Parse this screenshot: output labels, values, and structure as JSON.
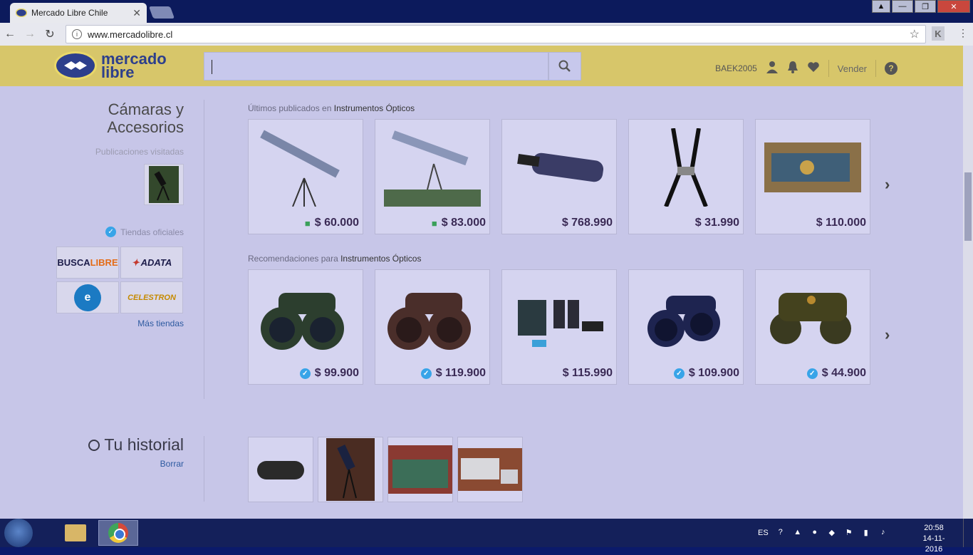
{
  "browser": {
    "tab_title": "Mercado Libre Chile",
    "tab_close": "✕",
    "url": "www.mercadolibre.cl",
    "nav": {
      "back": "←",
      "forward": "→",
      "reload": "↻"
    },
    "window_controls": {
      "user": "▲",
      "minimize": "—",
      "maximize": "❐",
      "close": "✕"
    },
    "extension_label": "K",
    "menu": "⋮"
  },
  "header": {
    "logo_line1": "mercado",
    "logo_line2": "libre",
    "search_placeholder": "",
    "username": "BAEK2005",
    "sell_label": "Vender",
    "help_label": "?"
  },
  "sidebar": {
    "category_line1": "Cámaras y",
    "category_line2": "Accesorios",
    "visited_label": "Publicaciones visitadas",
    "official_label": "Tiendas oficiales",
    "stores": [
      {
        "name_a": "BUSCA",
        "name_b": "LIBRE"
      },
      {
        "name": "ADATA"
      },
      {
        "name": "e-store"
      },
      {
        "name": "CELESTRON"
      }
    ],
    "more_stores": "Más tiendas"
  },
  "latest": {
    "title_prefix": "Últimos publicados en",
    "title_category": "Instrumentos Ópticos",
    "items": [
      {
        "price": "$ 60.000",
        "free_shipping": true
      },
      {
        "price": "$ 83.000",
        "free_shipping": true
      },
      {
        "price": "$ 768.990",
        "free_shipping": false
      },
      {
        "price": "$ 31.990",
        "free_shipping": false
      },
      {
        "price": "$ 110.000",
        "free_shipping": false
      }
    ]
  },
  "recommendations": {
    "title_prefix": "Recomendaciones para",
    "title_category": "Instrumentos Ópticos",
    "items": [
      {
        "price": "$ 99.900",
        "official": true
      },
      {
        "price": "$ 119.900",
        "official": true
      },
      {
        "price": "$ 115.990",
        "official": false
      },
      {
        "price": "$ 109.900",
        "official": true
      },
      {
        "price": "$ 44.900",
        "official": true
      }
    ]
  },
  "history": {
    "title": "Tu historial",
    "clear_label": "Borrar"
  },
  "taskbar": {
    "language": "ES",
    "time": "20:58",
    "date": "14-11-2016"
  },
  "colors": {
    "header_yellow": "#d7c66a",
    "brand_blue": "#2d3f8c",
    "check_blue": "#38a4e8",
    "shipping_green": "#3aa05a"
  }
}
